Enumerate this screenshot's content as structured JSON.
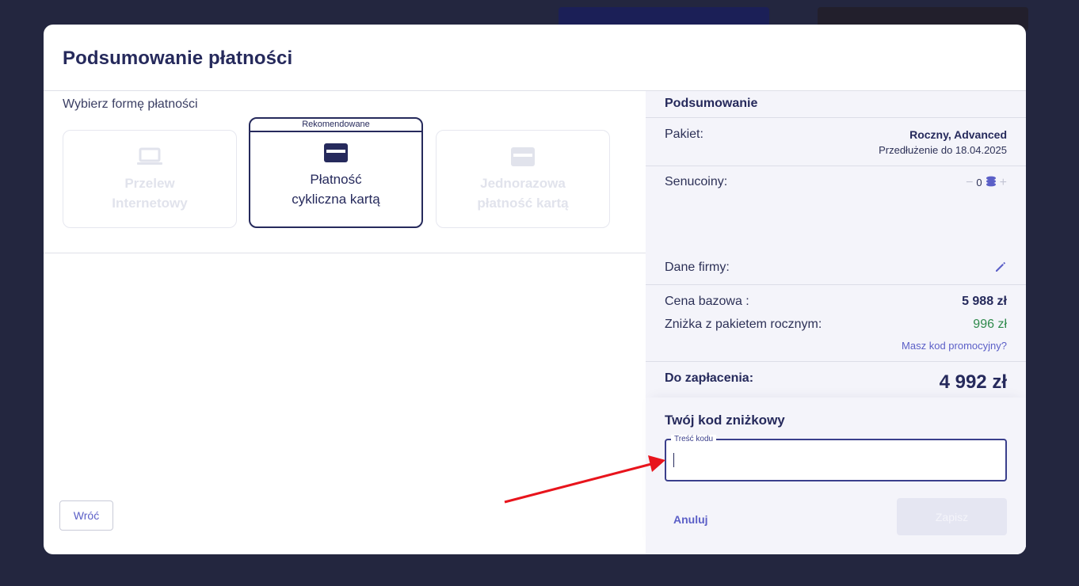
{
  "modal": {
    "title": "Podsumowanie płatności"
  },
  "payment": {
    "choose_label": "Wybierz formę płatności",
    "recommended_badge": "Rekomendowane",
    "methods": [
      {
        "label": "Przelew\nInternetowy",
        "icon": "laptop-icon",
        "state": "disabled"
      },
      {
        "label": "Płatność\ncykliczna kartą",
        "icon": "credit-card-icon",
        "state": "selected"
      },
      {
        "label": "Jednorazowa\npłatność kartą",
        "icon": "credit-card-icon",
        "state": "disabled"
      }
    ],
    "back_label": "Wróć"
  },
  "summary": {
    "title": "Podsumowanie",
    "package_label": "Pakiet:",
    "package_value": "Roczny, Advanced",
    "renewal": "Przedłużenie do 18.04.2025",
    "coins_label": "Senucoiny:",
    "coins_value": "0",
    "company_label": "Dane firmy:",
    "base_price_label": "Cena bazowa :",
    "base_price_value": "5 988 zł",
    "discount_label": "Zniżka z pakietem rocznym:",
    "discount_value": "996 zł",
    "promo_link": "Masz kod promocyjny?",
    "total_label": "Do zapłacenia:",
    "total_value": "4 992 zł"
  },
  "discount_code": {
    "title": "Twój kod zniżkowy",
    "field_label": "Treść kodu",
    "value": "",
    "cancel_label": "Anuluj",
    "save_label": "Zapisz"
  },
  "colors": {
    "accent": "#5b5fc7",
    "navy": "#262a5c",
    "discount_green": "#2f8a4c",
    "annotation_arrow": "#e8141c"
  }
}
